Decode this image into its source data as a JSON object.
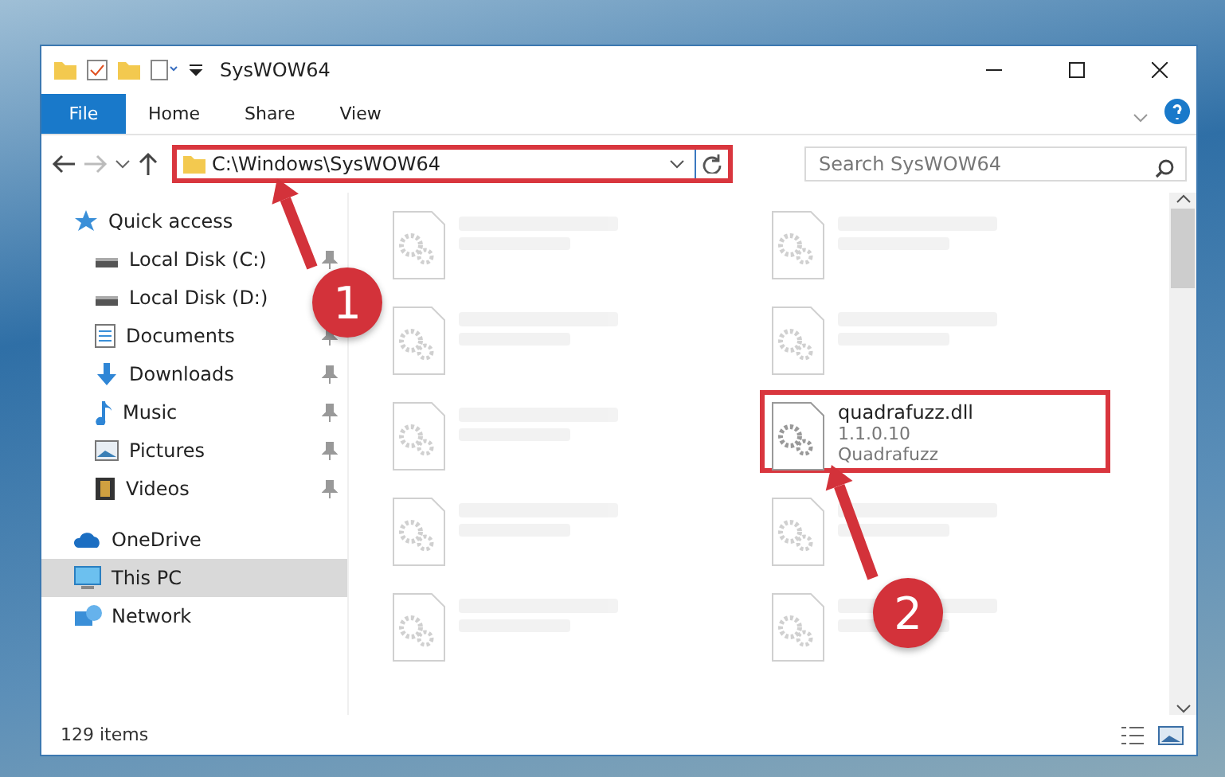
{
  "window": {
    "title": "SysWOW64"
  },
  "ribbon_tabs": [
    {
      "label": "File",
      "selected": true
    },
    {
      "label": "Home",
      "selected": false
    },
    {
      "label": "Share",
      "selected": false
    },
    {
      "label": "View",
      "selected": false
    }
  ],
  "address": {
    "path": "C:\\Windows\\SysWOW64",
    "highlighted": true
  },
  "search": {
    "placeholder": "Search SysWOW64"
  },
  "sidebar": {
    "items": [
      {
        "label": "Quick access",
        "kind": "quick",
        "selected": false,
        "children": [
          {
            "label": "Local Disk (C:)",
            "kind": "disk",
            "pinned": true
          },
          {
            "label": "Local Disk (D:)",
            "kind": "disk"
          },
          {
            "label": "Documents",
            "kind": "documents",
            "pinned": true
          },
          {
            "label": "Downloads",
            "kind": "downloads",
            "pinned": true
          },
          {
            "label": "Music",
            "kind": "music",
            "pinned": true
          },
          {
            "label": "Pictures",
            "kind": "pictures",
            "pinned": true
          },
          {
            "label": "Videos",
            "kind": "videos",
            "pinned": true
          }
        ]
      },
      {
        "label": "OneDrive",
        "kind": "onedrive",
        "selected": false
      },
      {
        "label": "This PC",
        "kind": "pc",
        "selected": true
      },
      {
        "label": "Network",
        "kind": "network",
        "selected": false
      }
    ]
  },
  "files": [
    {
      "kind": "blurred"
    },
    {
      "kind": "blurred"
    },
    {
      "kind": "blurred"
    },
    {
      "kind": "blurred"
    },
    {
      "kind": "blurred"
    },
    {
      "kind": "file",
      "name": "quadrafuzz.dll",
      "line_2": "1.1.0.10",
      "line_3": "Quadrafuzz",
      "highlighted": true
    },
    {
      "kind": "blurred"
    },
    {
      "kind": "blurred"
    },
    {
      "kind": "blurred"
    },
    {
      "kind": "blurred"
    }
  ],
  "annotations": [
    {
      "label": "1"
    },
    {
      "label": "2"
    }
  ],
  "status_bar": {
    "count": "129 items"
  }
}
